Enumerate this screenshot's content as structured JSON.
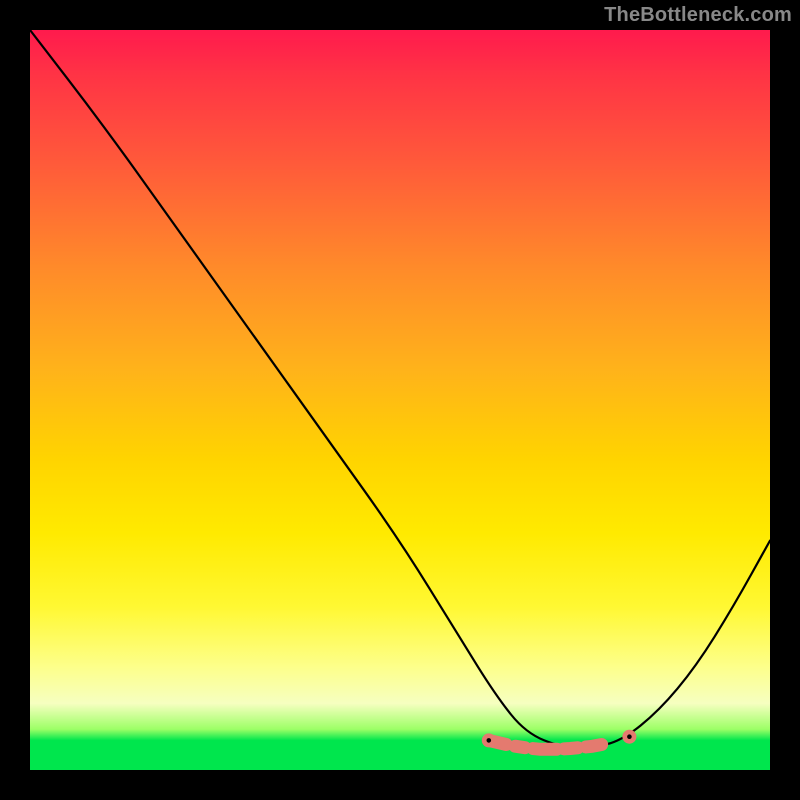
{
  "watermark": "TheBottleneck.com",
  "chart_data": {
    "type": "line",
    "title": "",
    "xlabel": "",
    "ylabel": "",
    "xlim": [
      0,
      100
    ],
    "ylim": [
      0,
      100
    ],
    "grid": false,
    "legend": false,
    "series": [
      {
        "name": "black-curve",
        "color": "#000000",
        "x": [
          0,
          10,
          20,
          30,
          40,
          50,
          58,
          63,
          67,
          72,
          76,
          80,
          85,
          90,
          95,
          100
        ],
        "y": [
          100,
          87,
          73,
          59,
          45,
          31,
          18,
          10,
          5,
          3,
          3,
          4,
          8,
          14,
          22,
          31
        ]
      },
      {
        "name": "salmon-markers",
        "color": "#e47a6f",
        "type": "scatter",
        "x": [
          62,
          65,
          67,
          69,
          71,
          73,
          76,
          79,
          81
        ],
        "y": [
          4,
          3.3,
          3,
          2.8,
          2.8,
          2.9,
          3.2,
          3.8,
          4.5
        ]
      }
    ],
    "background_gradient": {
      "stops": [
        {
          "pos": 0,
          "color": "#ff1a4d"
        },
        {
          "pos": 32,
          "color": "#ff8a2a"
        },
        {
          "pos": 58,
          "color": "#ffd400"
        },
        {
          "pos": 86,
          "color": "#fdff8a"
        },
        {
          "pos": 96,
          "color": "#00e64d"
        },
        {
          "pos": 100,
          "color": "#00e64d"
        }
      ]
    }
  }
}
